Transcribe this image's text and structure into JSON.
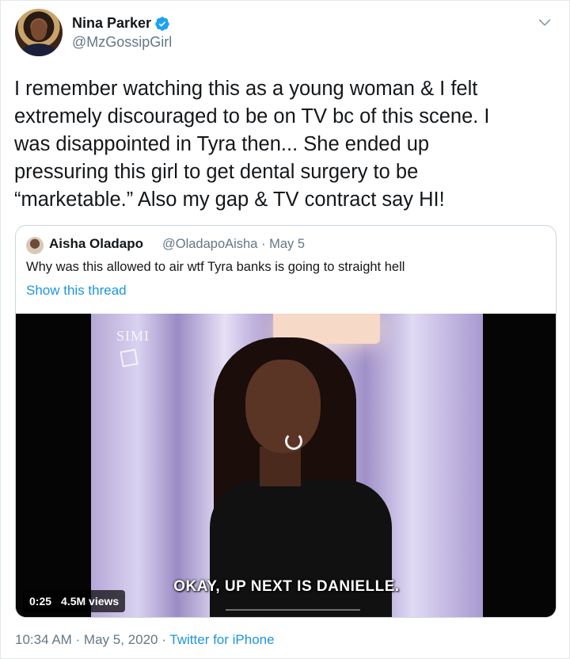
{
  "author": {
    "name": "Nina Parker",
    "handle": "@MzGossipGirl",
    "verified": true
  },
  "tweet": {
    "text": "I remember watching this as a young woman & I felt\nextremely discouraged to be on TV bc of this scene. I\nwas disappointed in Tyra then... She ended up\npressuring this girl to get dental surgery to be\n“marketable.” Also my gap & TV contract say HI!"
  },
  "quote": {
    "name": "Aisha Oladapo",
    "handle_date": "@OladapoAisha · May 5",
    "text": "Why was this allowed to air wtf Tyra banks is going to straight hell",
    "show_thread": "Show this thread",
    "video": {
      "watermark": "SIMI",
      "subtitle": "OKAY, UP NEXT IS DANIELLE.",
      "duration": "0:25",
      "views": "4.5M views"
    }
  },
  "footer": {
    "timestamp": "10:34 AM · May 5, 2020 · ",
    "source": "Twitter for iPhone"
  },
  "icons": {
    "verified": "verified-badge-icon",
    "menu": "chevron-down-icon"
  },
  "colors": {
    "accent": "#1b95e0",
    "secondary_text": "#657786",
    "verified": "#1da1f2"
  }
}
